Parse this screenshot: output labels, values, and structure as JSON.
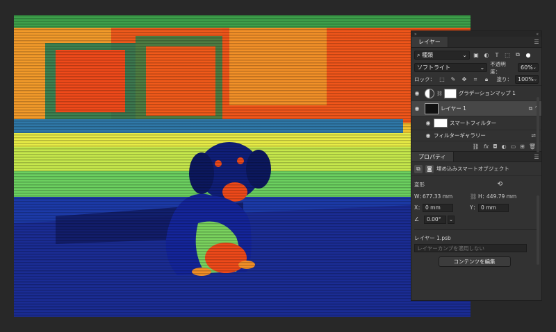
{
  "panel_topbar": {
    "left": "»",
    "right": "«"
  },
  "layers_panel": {
    "tab_label": "レイヤー",
    "menu_icon": "hamburger-icon",
    "filter_kind": "種類",
    "blend_mode": "ソフトライト",
    "opacity_label": "不透明度：",
    "opacity_value": "60%",
    "lock_label": "ロック：",
    "fill_label": "塗り：",
    "fill_value": "100%",
    "layers": [
      {
        "name": "グラデーションマップ 1",
        "type": "adjustment",
        "visible": true
      },
      {
        "name": "レイヤー 1",
        "type": "smart-object",
        "visible": true,
        "selected": true
      },
      {
        "name": "スマートフィルター",
        "type": "smart-filter",
        "visible": true
      },
      {
        "name": "フィルターギャラリー",
        "type": "filter",
        "visible": true
      }
    ]
  },
  "properties_panel": {
    "tab_label": "プロパティ",
    "object_type": "埋め込みスマートオブジェクト",
    "transform_label": "変形",
    "w_label": "W：",
    "w_value": "677.33 mm",
    "h_label": "H：",
    "h_value": "449.79 mm",
    "x_label": "X：",
    "x_value": "0 mm",
    "y_label": "Y：",
    "y_value": "0 mm",
    "angle_value": "0.00°",
    "file_name": "レイヤー 1.psb",
    "comp_placeholder": "レイヤーカンプを適用しない",
    "edit_contents_button": "コンテンツを編集"
  },
  "colors": {
    "workspace": "#282828",
    "panel": "#323232",
    "thermal_red": "#ef4a1a",
    "thermal_yellow": "#f4c830",
    "thermal_green": "#8cdc5a",
    "thermal_blue": "#1a2f9c"
  }
}
